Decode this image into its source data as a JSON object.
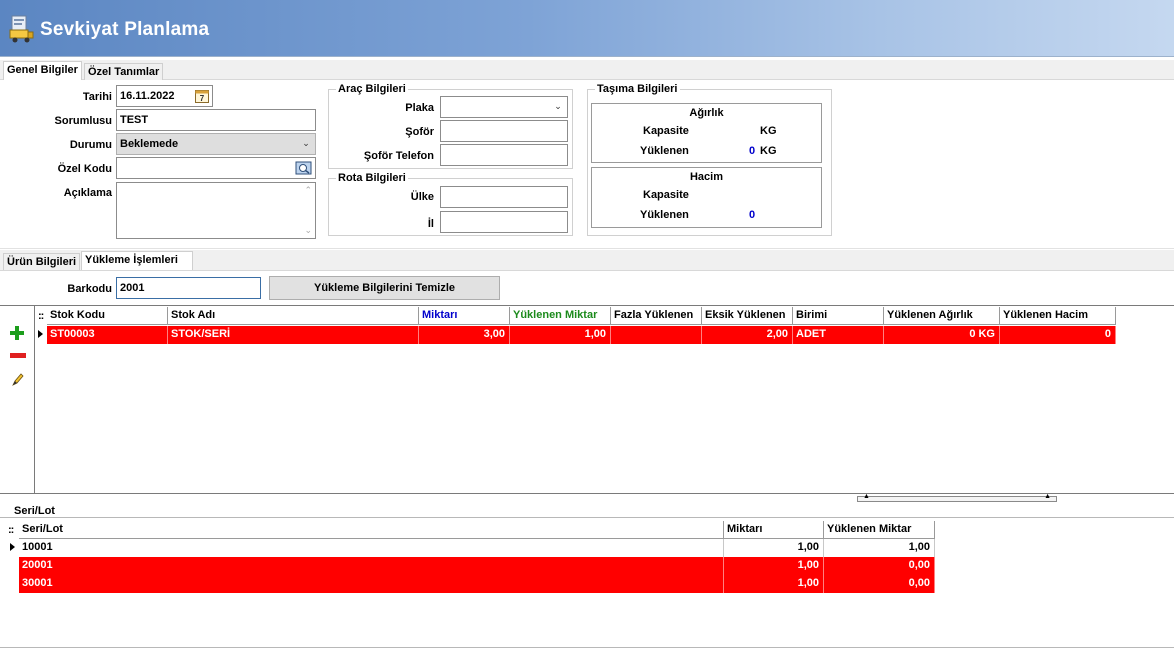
{
  "header": {
    "title": "Sevkiyat Planlama"
  },
  "top_tabs": [
    {
      "label": "Genel Bilgiler",
      "active": true
    },
    {
      "label": "Özel Tanımlar",
      "active": false
    }
  ],
  "general": {
    "date_label": "Tarihi",
    "date_value": "16.11.2022",
    "responsible_label": "Sorumlusu",
    "responsible_value": "TEST",
    "status_label": "Durumu",
    "status_value": "Beklemede",
    "special_code_label": "Özel Kodu",
    "special_code_value": "",
    "description_label": "Açıklama",
    "description_value": ""
  },
  "vehicle": {
    "title": "Araç Bilgileri",
    "plate_label": "Plaka",
    "plate_value": "",
    "driver_label": "Şoför",
    "driver_value": "",
    "driver_phone_label": "Şoför Telefon",
    "driver_phone_value": ""
  },
  "route": {
    "title": "Rota Bilgileri",
    "country_label": "Ülke",
    "country_value": "",
    "city_label": "İl",
    "city_value": ""
  },
  "transport": {
    "title": "Taşıma Bilgileri",
    "weight": {
      "title": "Ağırlık",
      "capacity_label": "Kapasite",
      "capacity_unit": "KG",
      "loaded_label": "Yüklenen",
      "loaded_value": "0",
      "loaded_unit": "KG"
    },
    "volume": {
      "title": "Hacim",
      "capacity_label": "Kapasite",
      "loaded_label": "Yüklenen",
      "loaded_value": "0"
    }
  },
  "bottom_tabs": [
    {
      "label": "Ürün Bilgileri",
      "active": false
    },
    {
      "label": "Yükleme İşlemleri",
      "active": true
    }
  ],
  "loading": {
    "barcode_label": "Barkodu",
    "barcode_value": "2001",
    "clear_button": "Yükleme Bilgilerini Temizle"
  },
  "colors": {
    "row_highlight": "#ff0000",
    "header_blue": "#0000cc",
    "header_green": "#1b8a1b",
    "add_green": "#1c9e1c",
    "remove_red": "#e02020"
  },
  "items_grid": {
    "columns": [
      "Stok Kodu",
      "Stok Adı",
      "Miktarı",
      "Yüklenen Miktar",
      "Fazla Yüklenen",
      "Eksik Yüklenen",
      "Birimi",
      "Yüklenen Ağırlık",
      "Yüklenen Hacim"
    ],
    "rows": [
      [
        "ST00003",
        "STOK/SERİ",
        "3,00",
        "1,00",
        "",
        "2,00",
        "ADET",
        "0 KG",
        "0"
      ]
    ]
  },
  "serial": {
    "section_label": "Seri/Lot",
    "columns": [
      "Seri/Lot",
      "Miktarı",
      "Yüklenen Miktar"
    ],
    "rows": [
      [
        "10001",
        "1,00",
        "1,00"
      ],
      [
        "20001",
        "1,00",
        "0,00"
      ],
      [
        "30001",
        "1,00",
        "0,00"
      ]
    ]
  }
}
